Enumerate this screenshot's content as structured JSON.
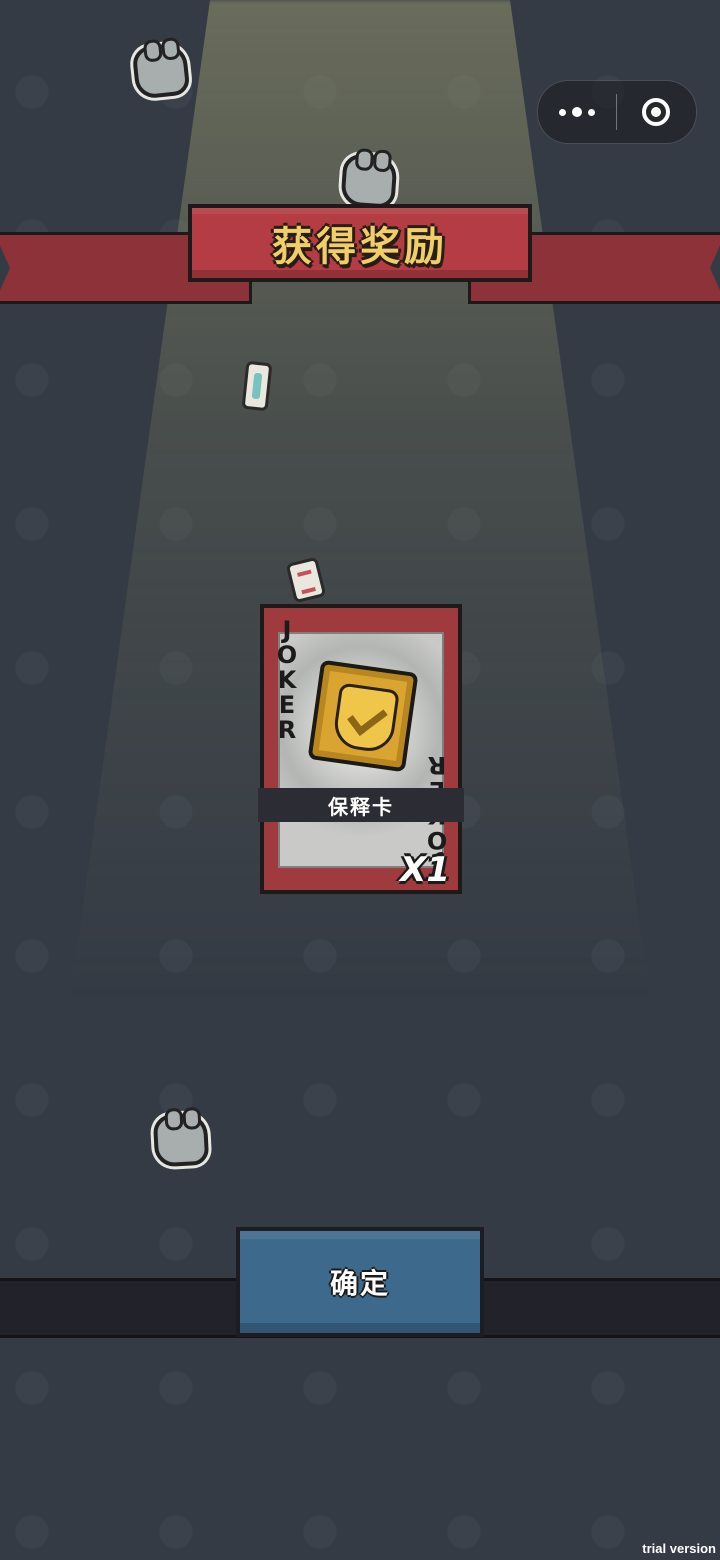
{
  "header": {
    "title": "获得奖励"
  },
  "capsule": {
    "more_icon": "more-dots-icon",
    "close_icon": "target-circle-icon"
  },
  "reward_card": {
    "corner_text": "JOKER",
    "corner_text_rotated": "JOKER",
    "name": "保释卡",
    "quantity": "X1",
    "icon": "gold-shield-check-icon"
  },
  "actions": {
    "confirm_label": "确定"
  },
  "watermark": {
    "text": "trial version"
  },
  "colors": {
    "background": "#353b45",
    "ribbon": "#b33c45",
    "title_gold": "#f0cf68",
    "card_frame": "#9f3a3e",
    "button_blue": "#3d6a8c"
  }
}
